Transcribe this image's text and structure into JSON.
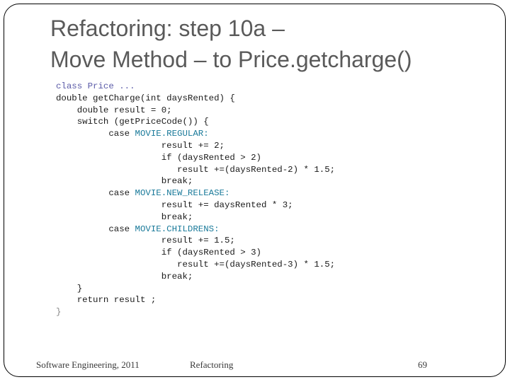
{
  "slide": {
    "title_line1": "Refactoring: step 10a –",
    "title_line2": "Move Method – to Price.getcharge()",
    "code": [
      {
        "indent": "",
        "parts": [
          {
            "t": "class Price ...",
            "c": "hdr"
          }
        ]
      },
      {
        "indent": "",
        "parts": [
          {
            "t": "double getCharge(int daysRented) {",
            "c": ""
          }
        ]
      },
      {
        "indent": "    ",
        "parts": [
          {
            "t": "double result = 0;",
            "c": ""
          }
        ]
      },
      {
        "indent": "    ",
        "parts": [
          {
            "t": "switch (getPriceCode()) {",
            "c": ""
          }
        ]
      },
      {
        "indent": "          ",
        "parts": [
          {
            "t": "case ",
            "c": ""
          },
          {
            "t": "MOVIE.REGULAR:",
            "c": "const"
          }
        ]
      },
      {
        "indent": "                    ",
        "parts": [
          {
            "t": "result += 2;",
            "c": ""
          }
        ]
      },
      {
        "indent": "                    ",
        "parts": [
          {
            "t": "if (daysRented > 2)",
            "c": ""
          }
        ]
      },
      {
        "indent": "                       ",
        "parts": [
          {
            "t": "result +=(daysRented-2) * 1.5;",
            "c": ""
          }
        ]
      },
      {
        "indent": "                    ",
        "parts": [
          {
            "t": "break;",
            "c": ""
          }
        ]
      },
      {
        "indent": "          ",
        "parts": [
          {
            "t": "case ",
            "c": ""
          },
          {
            "t": "MOVIE.NEW_RELEASE:",
            "c": "const"
          }
        ]
      },
      {
        "indent": "                    ",
        "parts": [
          {
            "t": "result += daysRented * 3;",
            "c": ""
          }
        ]
      },
      {
        "indent": "                    ",
        "parts": [
          {
            "t": "break;",
            "c": ""
          }
        ]
      },
      {
        "indent": "          ",
        "parts": [
          {
            "t": "case ",
            "c": ""
          },
          {
            "t": "MOVIE.CHILDRENS:",
            "c": "const"
          }
        ]
      },
      {
        "indent": "                    ",
        "parts": [
          {
            "t": "result += 1.5;",
            "c": ""
          }
        ]
      },
      {
        "indent": "                    ",
        "parts": [
          {
            "t": "if (daysRented > 3)",
            "c": ""
          }
        ]
      },
      {
        "indent": "                       ",
        "parts": [
          {
            "t": "result +=(daysRented-3) * 1.5;",
            "c": ""
          }
        ]
      },
      {
        "indent": "                    ",
        "parts": [
          {
            "t": "break;",
            "c": ""
          }
        ]
      },
      {
        "indent": "    ",
        "parts": [
          {
            "t": "}",
            "c": ""
          }
        ]
      },
      {
        "indent": "    ",
        "parts": [
          {
            "t": "return result ;",
            "c": ""
          }
        ]
      },
      {
        "indent": "",
        "parts": [
          {
            "t": "}",
            "c": "brace"
          }
        ]
      }
    ]
  },
  "footer": {
    "left": "Software Engineering, 2011",
    "center": "Refactoring",
    "page_number": "69"
  },
  "colors": {
    "title": "#5a5a5a",
    "class_header": "#5b5ba8",
    "constants": "#1a7a9a",
    "code": "#1a1a1a"
  }
}
